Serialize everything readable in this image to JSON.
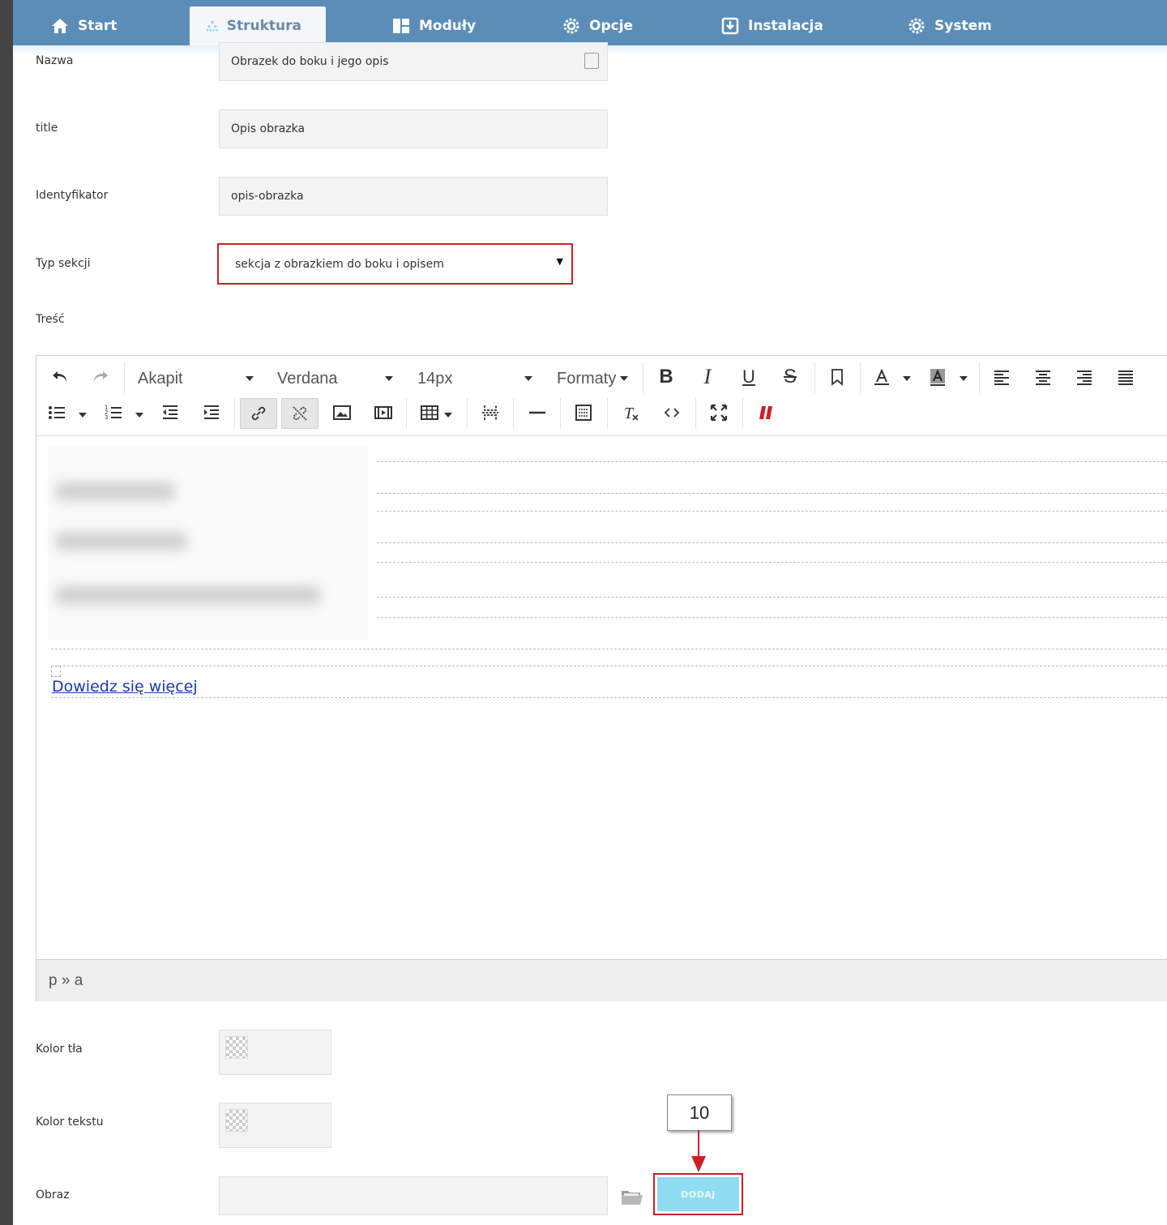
{
  "nav": {
    "items": [
      {
        "label": "Start",
        "icon": "home-icon"
      },
      {
        "label": "Struktura",
        "icon": "sitemap-icon",
        "active": true
      },
      {
        "label": "Moduły",
        "icon": "modules-icon"
      },
      {
        "label": "Opcje",
        "icon": "gear-icon"
      },
      {
        "label": "Instalacja",
        "icon": "install-icon"
      },
      {
        "label": "System",
        "icon": "gear-icon"
      }
    ]
  },
  "form": {
    "nazwa": {
      "label": "Nazwa",
      "value": "Obrazek do boku i jego opis"
    },
    "title": {
      "label": "title",
      "value": "Opis obrazka"
    },
    "identyfikator": {
      "label": "Identyfikator",
      "value": "opis-obrazka"
    },
    "typ_sekcji": {
      "label": "Typ sekcji",
      "value": "sekcja z obrazkiem do boku i opisem"
    },
    "tresc": {
      "label": "Treść"
    },
    "kolor_tla": {
      "label": "Kolor tła"
    },
    "kolor_tekstu": {
      "label": "Kolor tekstu"
    },
    "obraz": {
      "label": "Obraz",
      "value": ""
    }
  },
  "editor": {
    "toolbar": {
      "paragraph": "Akapit",
      "font": "Verdana",
      "size": "14px",
      "formats": "Formaty"
    },
    "link_text": "Dowiedz się więcej",
    "statusbar": "p » a"
  },
  "annotation": {
    "step": "10",
    "highlight_color": "#cc1f27"
  },
  "buttons": {
    "dodaj": "DODAJ"
  },
  "colors": {
    "topbar": "#5b8db8",
    "accent_light": "#8fdcf3",
    "link": "#1a3aa8"
  }
}
